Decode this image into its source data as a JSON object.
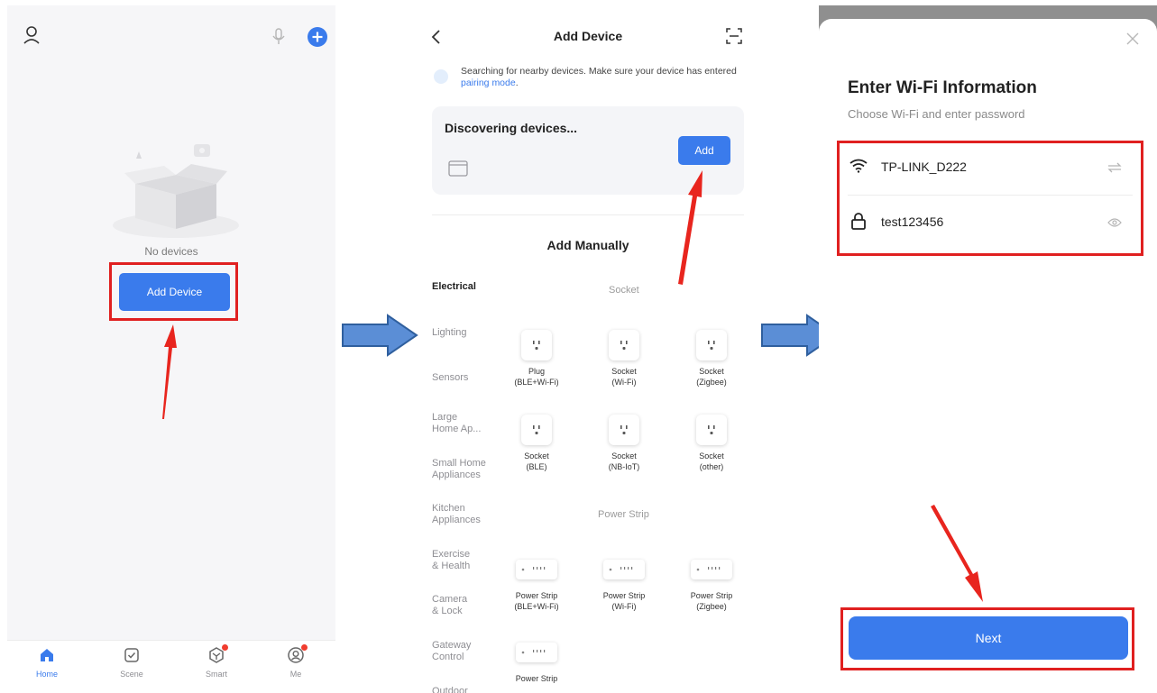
{
  "screen1": {
    "empty_text": "No devices",
    "add_device_button": "Add Device",
    "tabs": [
      {
        "label": "Home"
      },
      {
        "label": "Scene"
      },
      {
        "label": "Smart"
      },
      {
        "label": "Me"
      }
    ]
  },
  "screen2": {
    "title": "Add Device",
    "search_text": "Searching for nearby devices. Make sure your device has entered",
    "pairing_link": "pairing mode",
    "search_text_end": ".",
    "discovering_title": "Discovering devices...",
    "add_button": "Add",
    "add_manually_title": "Add Manually",
    "categories": [
      {
        "label": "Electrical"
      },
      {
        "label": "Lighting"
      },
      {
        "label": "Sensors"
      },
      {
        "label": "Large\nHome Ap..."
      },
      {
        "label": "Small Home\nAppliances"
      },
      {
        "label": "Kitchen\nAppliances"
      },
      {
        "label": "Exercise\n& Health"
      },
      {
        "label": "Camera\n& Lock"
      },
      {
        "label": "Gateway\nControl"
      },
      {
        "label": "Outdoor"
      }
    ],
    "section_socket": "Socket",
    "section_power_strip": "Power Strip",
    "socket_devices": [
      {
        "line1": "Plug",
        "line2": "(BLE+Wi-Fi)"
      },
      {
        "line1": "Socket",
        "line2": "(Wi-Fi)"
      },
      {
        "line1": "Socket",
        "line2": "(Zigbee)"
      },
      {
        "line1": "Socket",
        "line2": "(BLE)"
      },
      {
        "line1": "Socket",
        "line2": "(NB-IoT)"
      },
      {
        "line1": "Socket",
        "line2": "(other)"
      }
    ],
    "strip_devices": [
      {
        "line1": "Power Strip",
        "line2": "(BLE+Wi-Fi)"
      },
      {
        "line1": "Power Strip",
        "line2": "(Wi-Fi)"
      },
      {
        "line1": "Power Strip",
        "line2": "(Zigbee)"
      },
      {
        "line1": "Power Strip",
        "line2": ""
      }
    ]
  },
  "screen3": {
    "title": "Enter Wi-Fi Information",
    "subtitle": "Choose Wi-Fi and enter password",
    "wifi_name": "TP-LINK_D222",
    "password": "test123456",
    "next_button": "Next"
  },
  "colors": {
    "accent": "#3a7bec",
    "highlight": "#e02020",
    "arrow_fill": "#5b8ed6"
  }
}
